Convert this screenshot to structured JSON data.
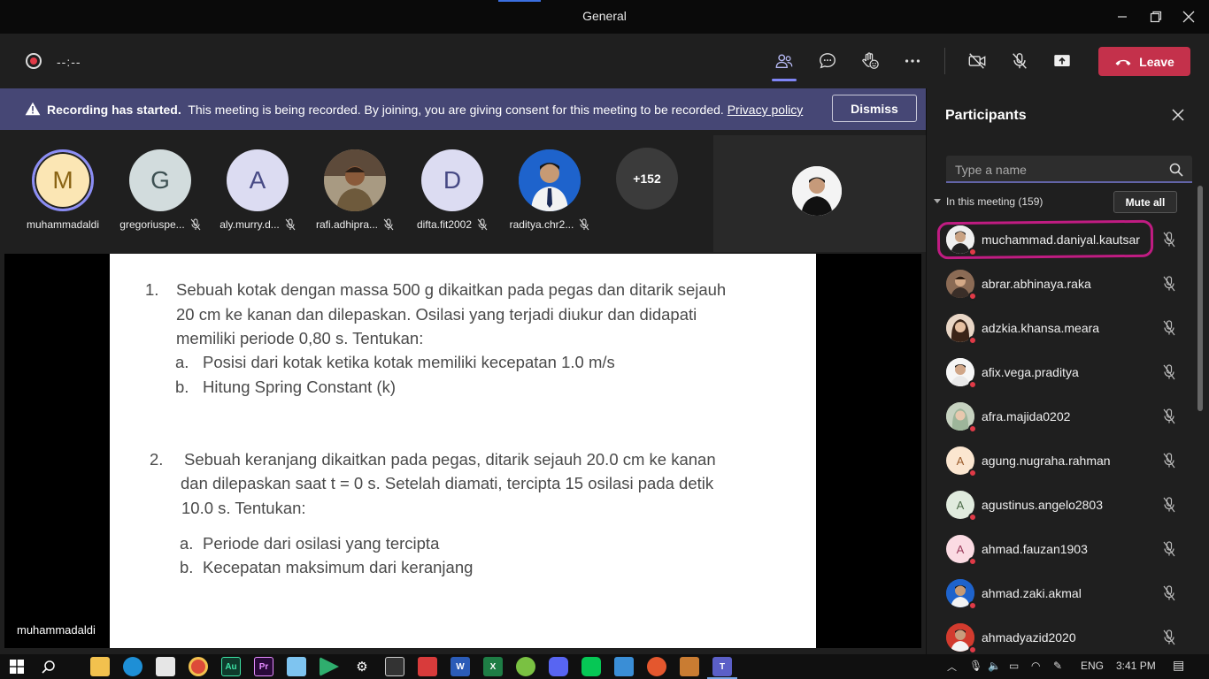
{
  "window": {
    "title": "General"
  },
  "toolbar": {
    "timer": "--:--",
    "leave_label": "Leave"
  },
  "banner": {
    "bold": "Recording has started.",
    "text": "This meeting is being recorded. By joining, you are giving consent for this meeting to be recorded.",
    "link": "Privacy policy",
    "dismiss_label": "Dismiss"
  },
  "gallery": {
    "tiles": [
      {
        "initial": "M",
        "name": "muhammadaldi"
      },
      {
        "initial": "G",
        "name": "gregoriuspe..."
      },
      {
        "initial": "A",
        "name": "aly.murry.d..."
      },
      {
        "initial": "",
        "name": "rafi.adhipra..."
      },
      {
        "initial": "D",
        "name": "difta.fit2002"
      },
      {
        "initial": "",
        "name": "raditya.chr2..."
      },
      {
        "initial": "+152",
        "name": ""
      }
    ]
  },
  "stage": {
    "presenter": "muhammadaldi",
    "q1": {
      "num": "1.",
      "line1": "Sebuah kotak dengan massa 500 g dikaitkan pada pegas dan ditarik sejauh",
      "line2": "20 cm ke kanan dan dilepaskan. Osilasi yang terjadi diukur dan didapati",
      "line3": "memiliki periode 0,80 s. Tentukan:",
      "a_label": "a.",
      "a": "Posisi dari kotak ketika kotak memiliki kecepatan 1.0 m/s",
      "b_label": "b.",
      "b": "Hitung Spring Constant (k)"
    },
    "q2": {
      "num": "2.",
      "line1": "Sebuah keranjang dikaitkan pada pegas, ditarik sejauh 20.0 cm ke kanan",
      "line2": "dan dilepaskan saat t = 0 s. Setelah diamati, tercipta 15 osilasi pada detik",
      "line3": "10.0 s. Tentukan:",
      "a_label": "a.",
      "a": "Periode dari osilasi yang tercipta",
      "b_label": "b.",
      "b": "Kecepatan maksimum dari keranjang"
    }
  },
  "participants": {
    "title": "Participants",
    "search_placeholder": "Type a name",
    "section": "In this meeting (159)",
    "mute_all": "Mute all",
    "list": [
      {
        "name": "muchammad.daniyal.kautsar",
        "initial": ""
      },
      {
        "name": "abrar.abhinaya.raka",
        "initial": ""
      },
      {
        "name": "adzkia.khansa.meara",
        "initial": ""
      },
      {
        "name": "afix.vega.praditya",
        "initial": ""
      },
      {
        "name": "afra.majida0202",
        "initial": ""
      },
      {
        "name": "agung.nugraha.rahman",
        "initial": "A"
      },
      {
        "name": "agustinus.angelo2803",
        "initial": "A"
      },
      {
        "name": "ahmad.fauzan1903",
        "initial": "A"
      },
      {
        "name": "ahmad.zaki.akmal",
        "initial": ""
      },
      {
        "name": "ahmadyazid2020",
        "initial": ""
      }
    ]
  },
  "taskbar": {
    "lang": "ENG",
    "time": "3:41 PM"
  }
}
